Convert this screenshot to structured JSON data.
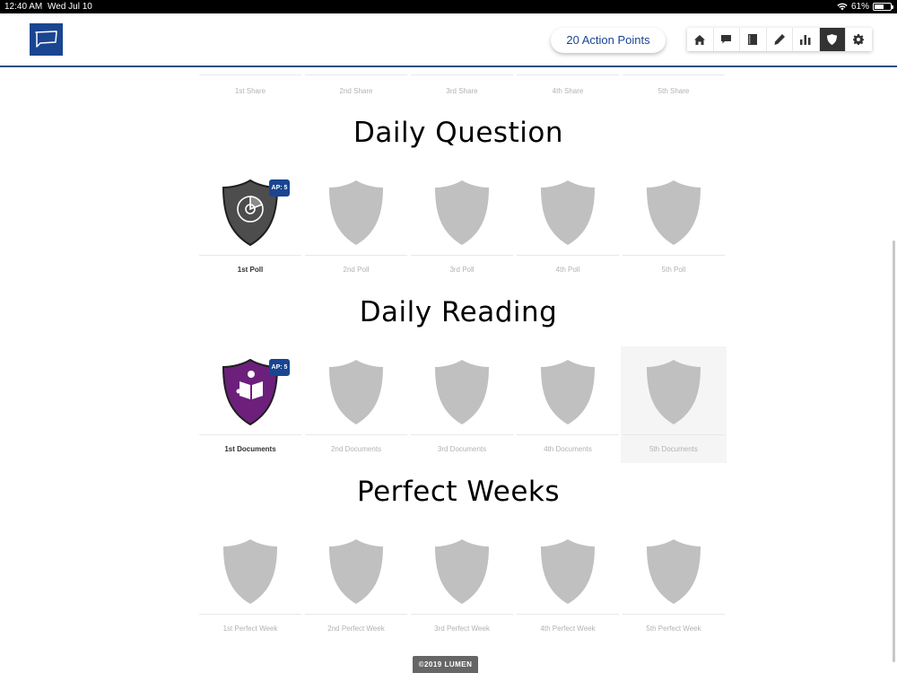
{
  "status_bar": {
    "time": "12:40 AM",
    "date": "Wed Jul 10",
    "battery_percent": "61%",
    "battery_level": 0.61
  },
  "header": {
    "logo_icon": "speech-flag-icon",
    "action_points": "20 Action Points",
    "toolbar": [
      {
        "icon": "home-icon",
        "active": false
      },
      {
        "icon": "chat-icon",
        "active": false
      },
      {
        "icon": "notebook-icon",
        "active": false
      },
      {
        "icon": "pencil-icon",
        "active": false
      },
      {
        "icon": "bar-chart-icon",
        "active": false
      },
      {
        "icon": "shield-icon",
        "active": true
      },
      {
        "icon": "gear-icon",
        "active": false
      }
    ]
  },
  "shares": {
    "labels": [
      "1st Share",
      "2nd Share",
      "3rd Share",
      "4th Share",
      "5th Share"
    ]
  },
  "daily_question": {
    "title": "Daily Question",
    "badges": [
      {
        "label": "1st Poll",
        "earned": true,
        "ap": "AP: 5",
        "color": "#4d4d4d",
        "icon": "pie-chart-icon"
      },
      {
        "label": "2nd Poll",
        "earned": false
      },
      {
        "label": "3rd Poll",
        "earned": false
      },
      {
        "label": "4th Poll",
        "earned": false
      },
      {
        "label": "5th Poll",
        "earned": false
      }
    ]
  },
  "daily_reading": {
    "title": "Daily Reading",
    "badges": [
      {
        "label": "1st Documents",
        "earned": true,
        "ap": "AP: 5",
        "color": "#6d1f7c",
        "icon": "reading-icon"
      },
      {
        "label": "2nd Documents",
        "earned": false
      },
      {
        "label": "3rd Documents",
        "earned": false
      },
      {
        "label": "4th Documents",
        "earned": false
      },
      {
        "label": "5th Documents",
        "earned": false
      }
    ]
  },
  "perfect_weeks": {
    "title": "Perfect Weeks",
    "badges": [
      {
        "label": "1st Perfect Week",
        "earned": false
      },
      {
        "label": "2nd Perfect Week",
        "earned": false
      },
      {
        "label": "3rd Perfect Week",
        "earned": false
      },
      {
        "label": "4th Perfect Week",
        "earned": false
      },
      {
        "label": "5th Perfect Week",
        "earned": false
      }
    ]
  },
  "colors": {
    "brand": "#1a4591",
    "locked_shield": "#c0c0c0"
  },
  "footer": {
    "text": "©2019 LUMEN"
  }
}
